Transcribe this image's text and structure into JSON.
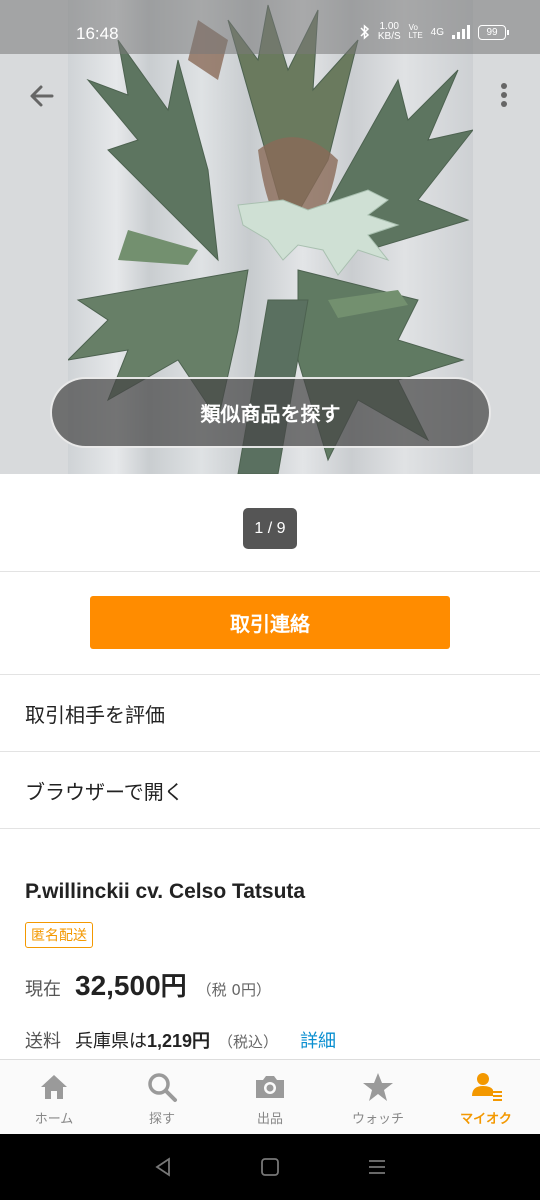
{
  "status_bar": {
    "time": "16:48",
    "net_speed_value": "1.00",
    "net_speed_unit": "KB/S",
    "volte": "Vo LTE",
    "network": "4G",
    "battery": "99"
  },
  "image_viewer": {
    "similar_button": "類似商品を探す",
    "pager": "1 / 9"
  },
  "actions": {
    "contact_button": "取引連絡",
    "rate_partner": "取引相手を評価",
    "open_browser": "ブラウザーで開く"
  },
  "item": {
    "title": "P.willinckii cv. Celso Tatsuta",
    "badge": "匿名配送",
    "price_label": "現在",
    "price_value": "32,500",
    "price_yen": "円",
    "price_tax": "（税 0円）",
    "shipping_label": "送料",
    "shipping_text": "兵庫県は",
    "shipping_amount": "1,219円",
    "shipping_tax": "（税込）",
    "shipping_detail": "詳細"
  },
  "bottom_nav": {
    "items": [
      {
        "label": "ホーム",
        "icon": "home-icon"
      },
      {
        "label": "探す",
        "icon": "search-icon"
      },
      {
        "label": "出品",
        "icon": "camera-icon"
      },
      {
        "label": "ウォッチ",
        "icon": "star-icon"
      },
      {
        "label": "マイオク",
        "icon": "user-list-icon"
      }
    ],
    "active_index": 4
  },
  "colors": {
    "accent": "#ff8c00",
    "active_nav": "#f39800",
    "link": "#0a8fd0"
  }
}
